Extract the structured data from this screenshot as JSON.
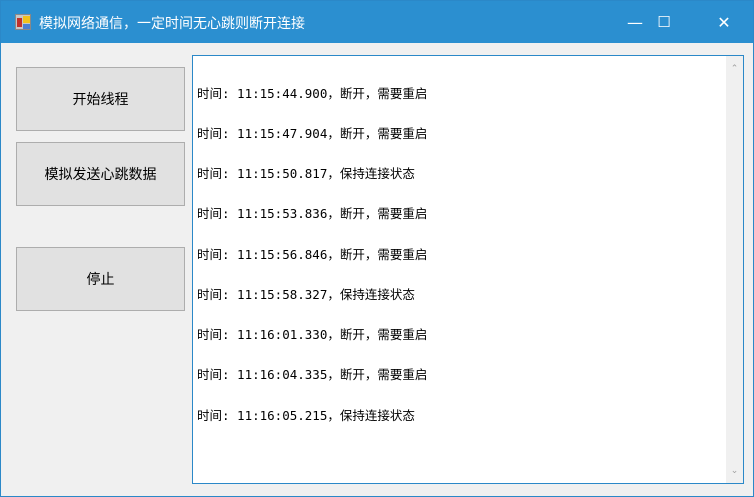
{
  "window": {
    "title": "模拟网络通信，一定时间无心跳则断开连接",
    "minimize": "—",
    "maximize": "☐",
    "close": "✕"
  },
  "buttons": {
    "start": "开始线程",
    "heartbeat": "模拟发送心跳数据",
    "stop": "停止"
  },
  "log": {
    "lines": [
      "时间: 11:15:44.900，断开，需要重启",
      "时间: 11:15:47.904，断开，需要重启",
      "时间: 11:15:50.817，保持连接状态",
      "时间: 11:15:53.836，断开，需要重启",
      "时间: 11:15:56.846，断开，需要重启",
      "时间: 11:15:58.327，保持连接状态",
      "时间: 11:16:01.330，断开，需要重启",
      "时间: 11:16:04.335，断开，需要重启",
      "时间: 11:16:05.215，保持连接状态"
    ]
  },
  "scroll": {
    "up": "⌃",
    "down": "⌄"
  }
}
